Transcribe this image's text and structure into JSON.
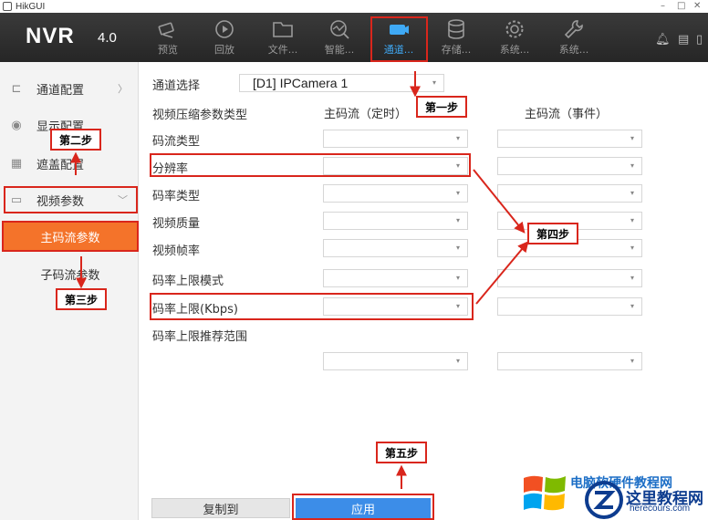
{
  "window": {
    "title": "HikGUI"
  },
  "logo": {
    "name": "NVR",
    "version": "4.0"
  },
  "nav": [
    {
      "label": "预览",
      "icon": "camera-icon"
    },
    {
      "label": "回放",
      "icon": "playback-icon"
    },
    {
      "label": "文件...",
      "icon": "folder-icon"
    },
    {
      "label": "智能...",
      "icon": "smart-icon"
    },
    {
      "label": "通道...",
      "icon": "channel-icon"
    },
    {
      "label": "存储...",
      "icon": "storage-icon"
    },
    {
      "label": "系统...",
      "icon": "gear-icon"
    },
    {
      "label": "系统...",
      "icon": "wrench-icon"
    }
  ],
  "sidebar": {
    "items": [
      {
        "label": "通道配置",
        "icon": "channel-config-icon"
      },
      {
        "label": "显示配置",
        "icon": "eye-icon"
      },
      {
        "label": "遮盖配置",
        "icon": "mask-icon"
      },
      {
        "label": "视频参数",
        "icon": "video-param-icon"
      }
    ],
    "sub_items": [
      {
        "label": "主码流参数"
      },
      {
        "label": "子码流参数"
      }
    ]
  },
  "form": {
    "channel_label": "通道选择",
    "channel_value": "[D1] IPCamera 1",
    "compression_label": "视频压缩参数类型",
    "col_main_timed": "主码流（定时）",
    "col_main_event": "主码流（事件）",
    "rows": [
      {
        "label": "码流类型"
      },
      {
        "label": "分辨率"
      },
      {
        "label": "码率类型"
      },
      {
        "label": "视频质量"
      },
      {
        "label": "视频帧率"
      },
      {
        "label": "码率上限模式"
      },
      {
        "label": "码率上限(Kbps)"
      },
      {
        "label": "码率上限推荐范围"
      }
    ]
  },
  "buttons": {
    "copy": "复制到",
    "apply": "应用"
  },
  "annotations": {
    "step1": "第一步",
    "step2": "第二步",
    "step3": "第三步",
    "step4": "第四步",
    "step5": "第五步"
  },
  "watermark": {
    "title": "电脑软硬件教程网",
    "main": "这里教程网",
    "url": "herecours.com"
  },
  "colors": {
    "accent_orange": "#f4732a",
    "apply_blue": "#3c8de8",
    "nav_active": "#3fa9f5",
    "annotation_red": "#d9261c"
  }
}
